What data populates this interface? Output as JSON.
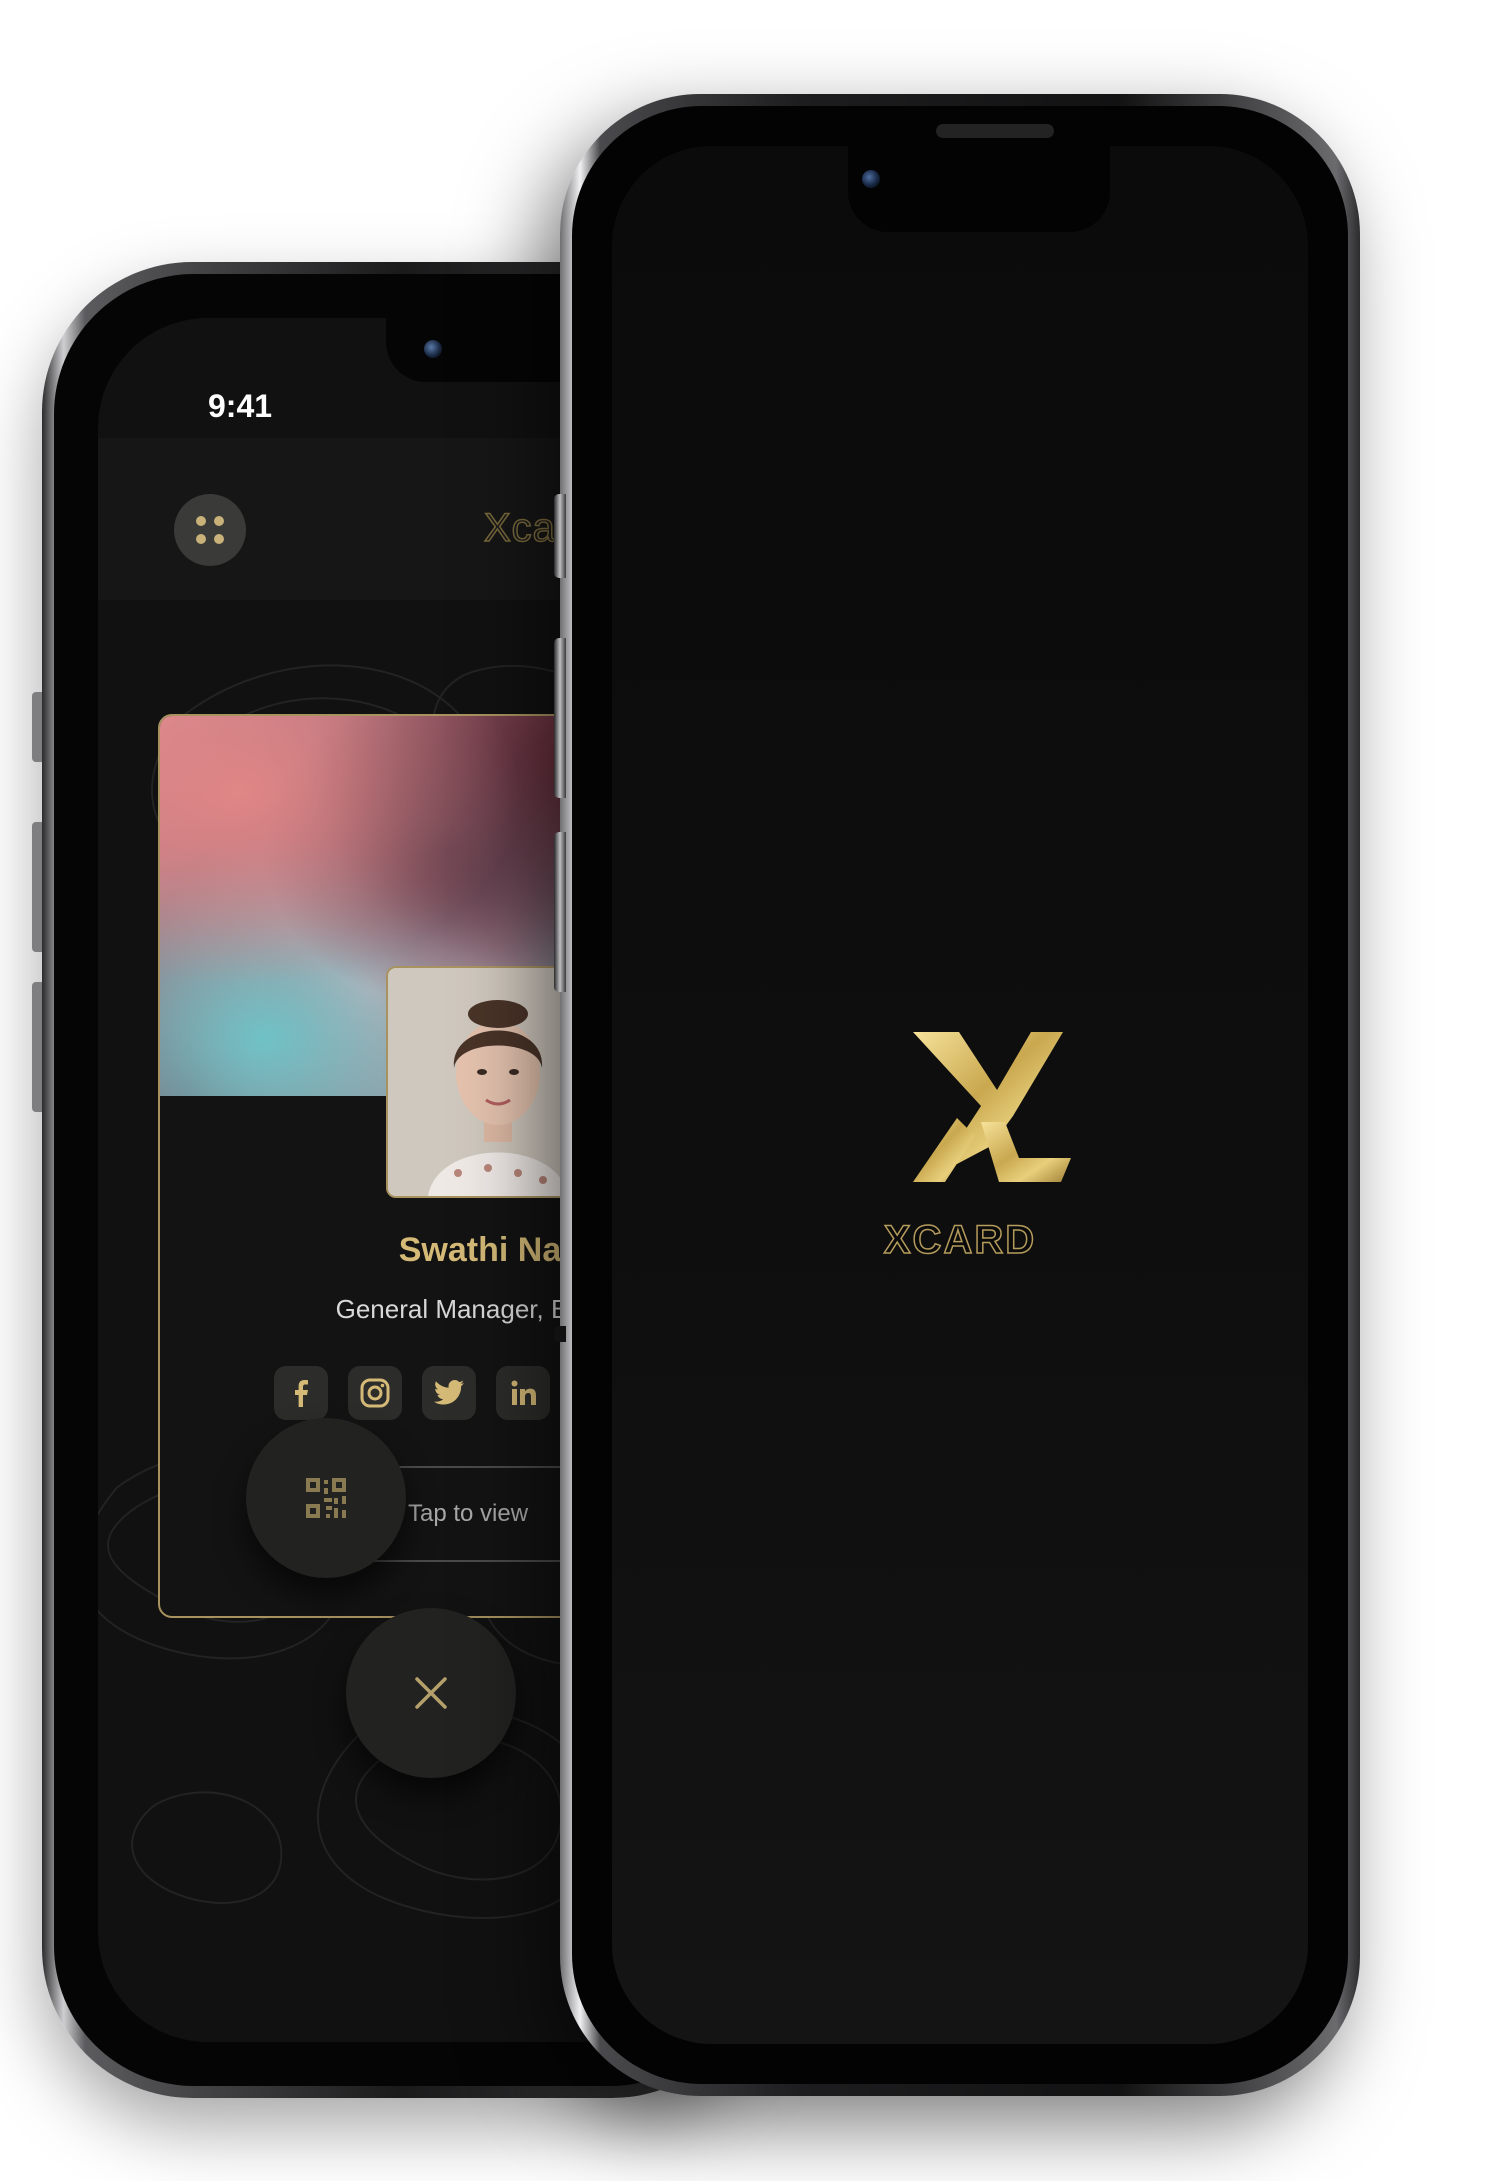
{
  "status_bar": {
    "time": "9:41"
  },
  "app_header": {
    "brand": "Xcard",
    "menu_icon": "grid-dots-icon"
  },
  "profile_card": {
    "name": "Swathi Na",
    "role": "General Manager, BPC",
    "social_icons": [
      "facebook-icon",
      "instagram-icon",
      "twitter-icon",
      "linkedin-icon"
    ],
    "tap_label": "Tap to view"
  },
  "bottom_actions": {
    "qr_icon": "qr-code-icon",
    "close_icon": "close-icon"
  },
  "splash": {
    "logo_icon": "xcard-logo-icon",
    "brand": "XCARD"
  },
  "colors": {
    "gold": "#d4b977",
    "gold_dark": "#a89360",
    "screen_bg": "#111111"
  }
}
